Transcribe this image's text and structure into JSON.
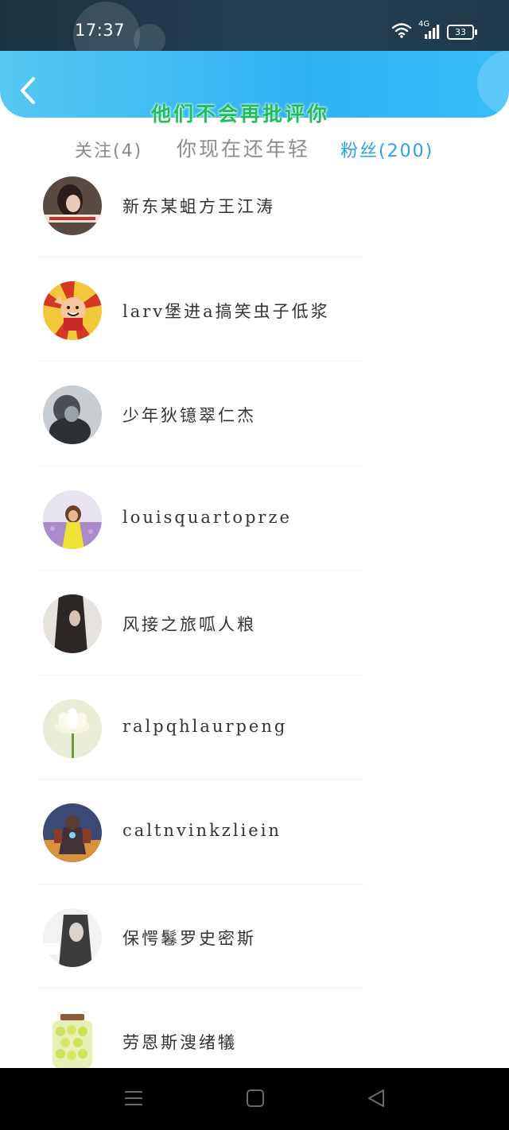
{
  "status_bar": {
    "time": "17:37",
    "network": "4G",
    "battery": "33",
    "icons": [
      "wifi-icon",
      "signal-icon",
      "battery-icon"
    ]
  },
  "header": {
    "back_icon": "chevron-left-icon",
    "overlay_line_1": "他们不会再批评你",
    "overlay_line_2": "你现在还年轻"
  },
  "tabs": {
    "following": "关注(4)",
    "fans": "粉丝(200)"
  },
  "users": [
    {
      "name": "新东某蛆方王江涛",
      "avatar": "photo-avatar"
    },
    {
      "name": "larv堡进a搞笑虫子低浆",
      "avatar": "cartoon-avatar"
    },
    {
      "name": "少年狄镱翠仁杰",
      "avatar": "photo-avatar"
    },
    {
      "name": "louisquartoprze",
      "avatar": "photo-avatar"
    },
    {
      "name": "风接之旅呱人粮",
      "avatar": "photo-avatar"
    },
    {
      "name": "ralpqhlaurpeng",
      "avatar": "lotus-avatar"
    },
    {
      "name": "caltnvinkzliein",
      "avatar": "game-character-avatar"
    },
    {
      "name": "保愕鬈罗史密斯",
      "avatar": "photo-avatar"
    },
    {
      "name": "劳恩斯溲绪犠",
      "avatar": "jar-avatar"
    }
  ],
  "nav": {
    "menu_icon": "menu-icon",
    "home_icon": "home-icon",
    "back_icon": "back-triangle-icon"
  },
  "colors": {
    "header_blue": "#2fb2f3",
    "tab_active": "#2ba3e4",
    "overlay_green": "#1fbf58"
  }
}
